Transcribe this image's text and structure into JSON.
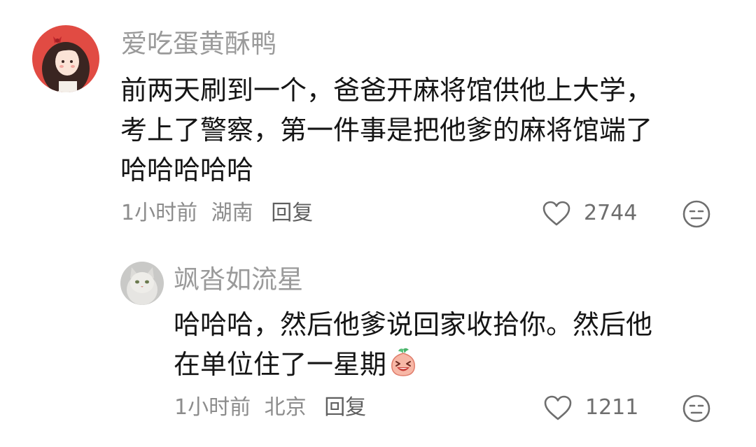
{
  "comments": [
    {
      "username": "爱吃蛋黄酥鸭",
      "lines": [
        "前两天刷到一个，爸爸开麻将馆供他上大学，",
        "考上了警察，第一件事是把他爹的麻将馆端了",
        "哈哈哈哈哈"
      ],
      "time": "1小时前",
      "location": "湖南",
      "reply_label": "回复",
      "likes": "2744",
      "avatar_icon": "girl-avatar-icon"
    },
    {
      "username": "飒沓如流星",
      "lines": [
        "哈哈哈，然后他爹说回家收拾你。然后他",
        "在单位住了一星期"
      ],
      "time": "1小时前",
      "location": "北京",
      "reply_label": "回复",
      "likes": "1211",
      "avatar_icon": "cat-avatar-icon",
      "inline_emoji": "laughing-emoji-icon"
    }
  ],
  "colors": {
    "username": "#9a9a9a",
    "text": "#151515",
    "meta": "#8c8c8c",
    "icon": "#6e6e6e"
  }
}
